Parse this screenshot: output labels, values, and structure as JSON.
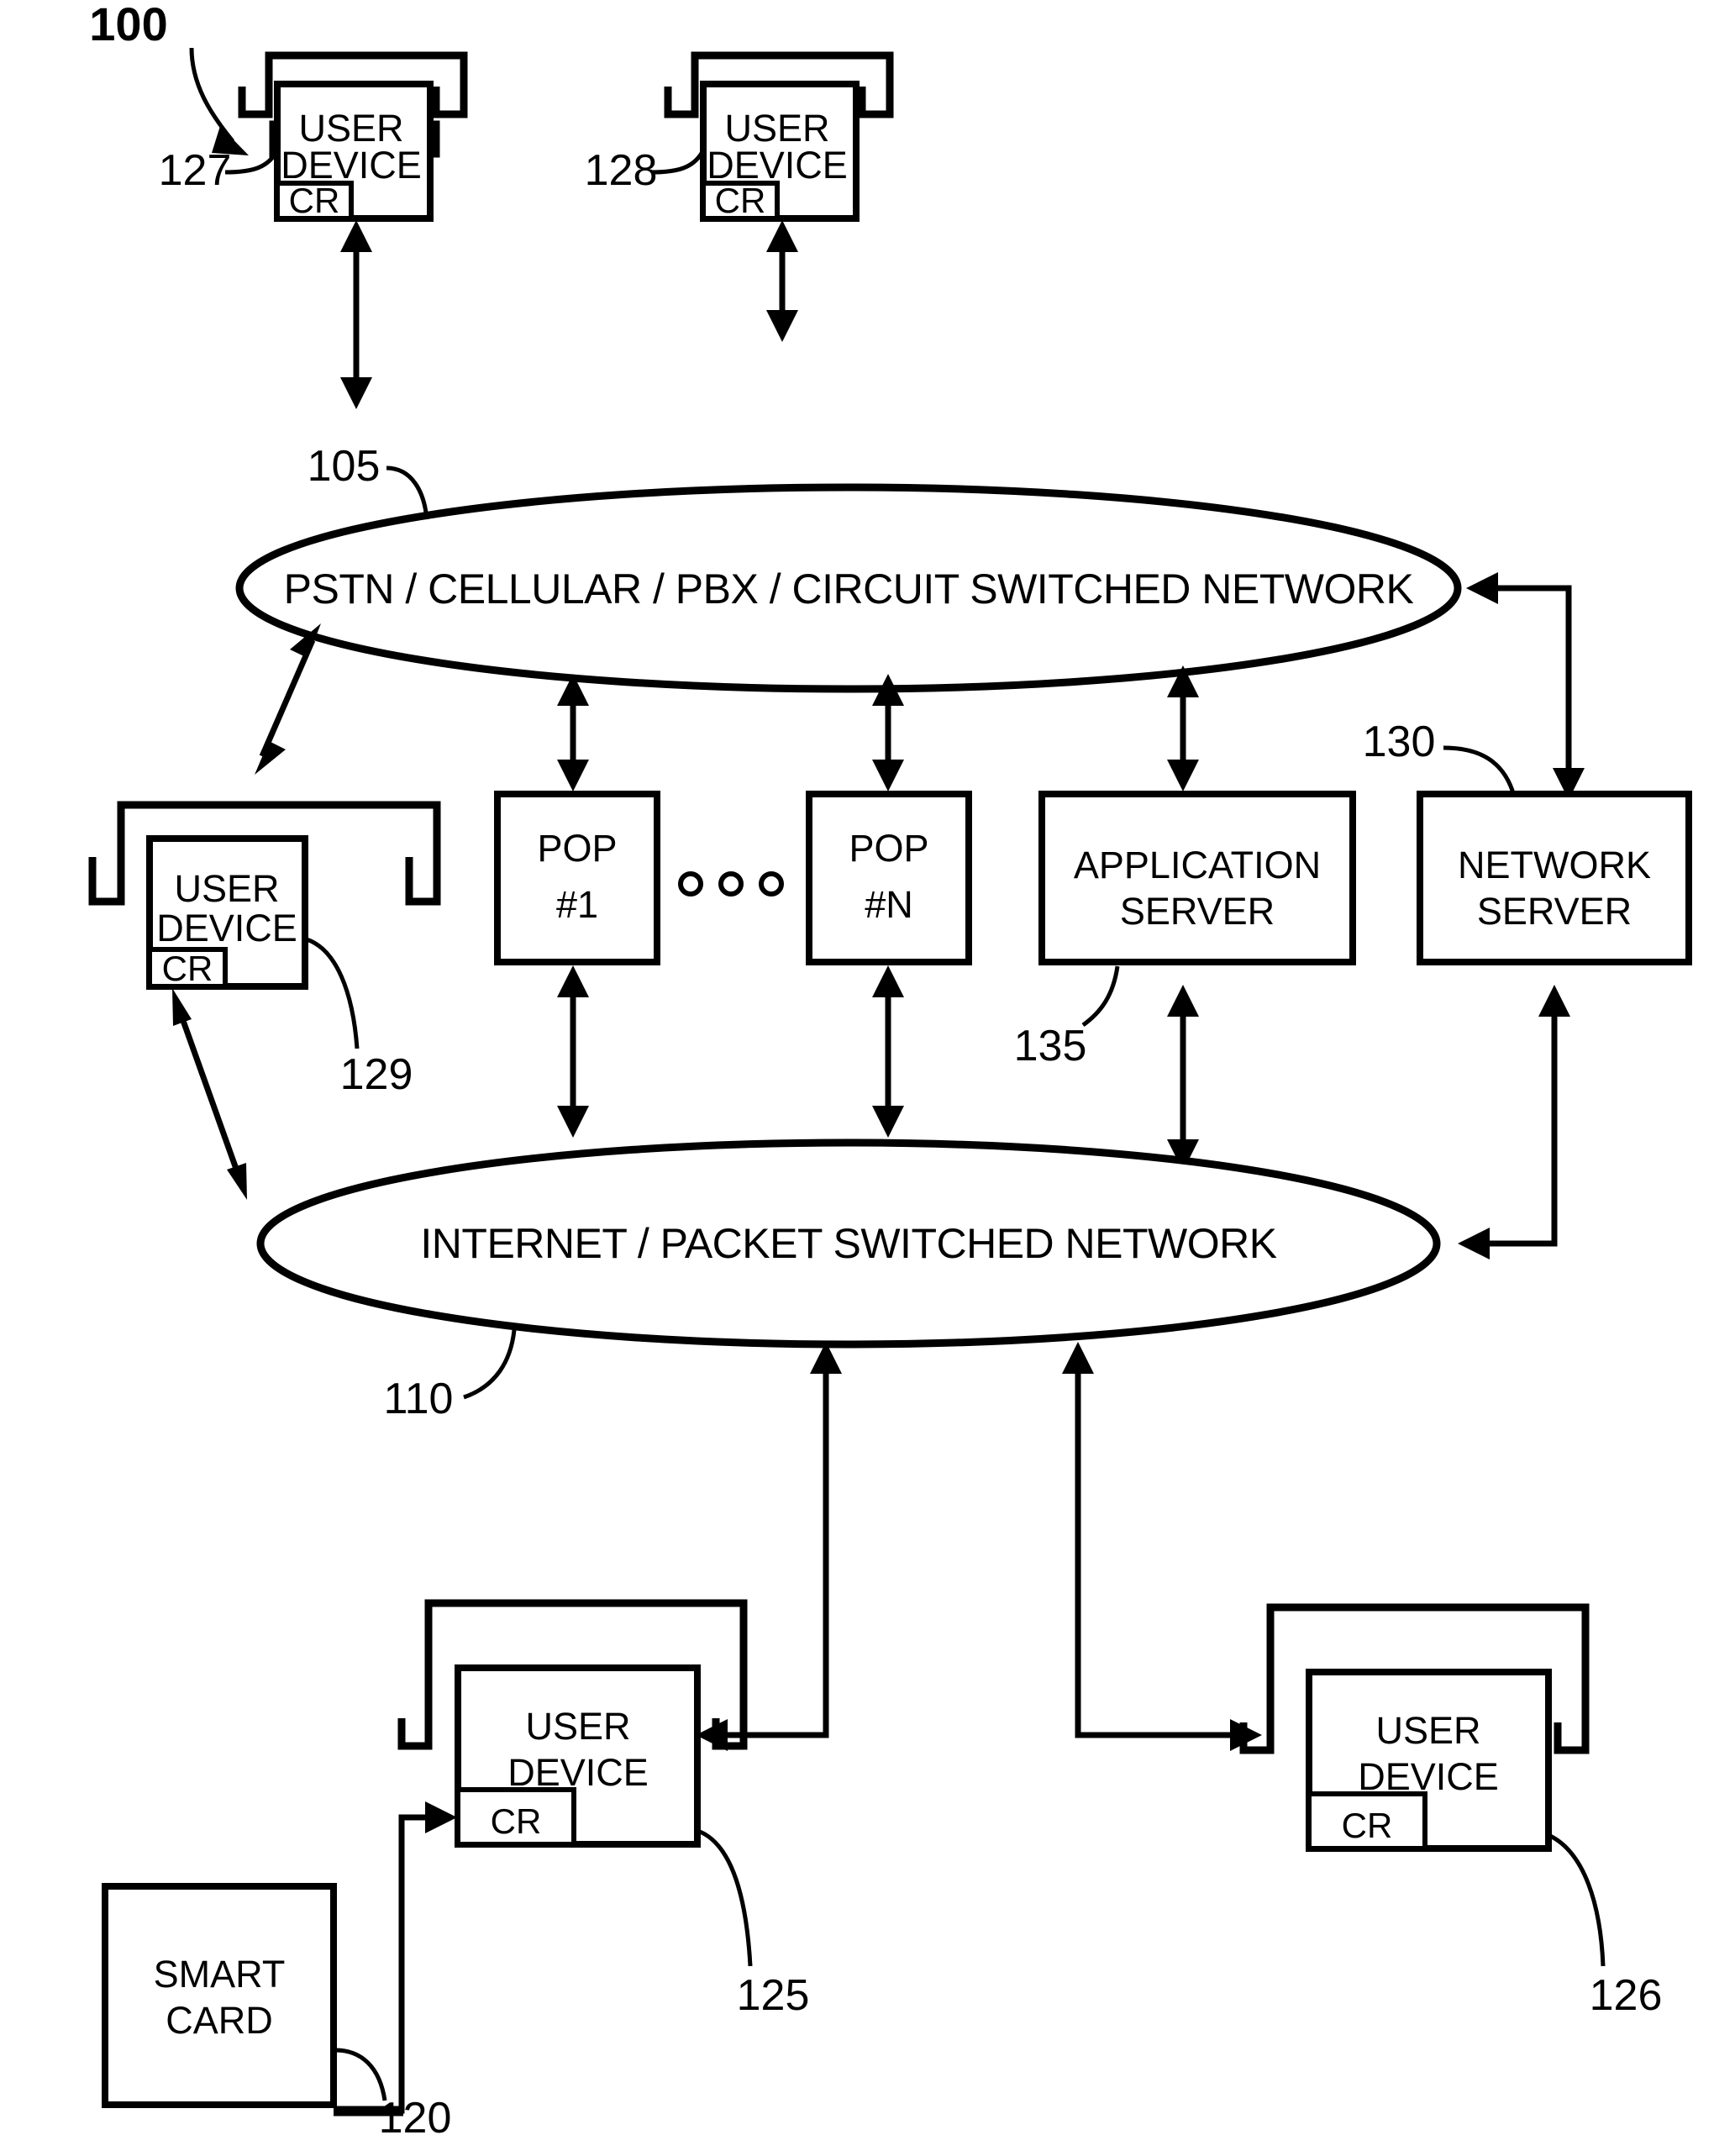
{
  "figure": {
    "number": "100"
  },
  "networks": [
    {
      "id": "pstn",
      "label": "PSTN / CELLULAR / PBX / CIRCUIT SWITCHED NETWORK",
      "ref": "105"
    },
    {
      "id": "internet",
      "label": "INTERNET / PACKET SWITCHED NETWORK",
      "ref": "110"
    }
  ],
  "user_devices": [
    {
      "id": "ud127",
      "line1": "USER",
      "line2": "DEVICE",
      "module": "CR",
      "ref": "127"
    },
    {
      "id": "ud128",
      "line1": "USER",
      "line2": "DEVICE",
      "module": "CR",
      "ref": "128"
    },
    {
      "id": "ud129",
      "line1": "USER",
      "line2": "DEVICE",
      "module": "CR",
      "ref": "129"
    },
    {
      "id": "ud125",
      "line1": "USER",
      "line2": "DEVICE",
      "module": "CR",
      "ref": "125"
    },
    {
      "id": "ud126",
      "line1": "USER",
      "line2": "DEVICE",
      "module": "CR",
      "ref": "126"
    }
  ],
  "pops": [
    {
      "id": "pop1",
      "line1": "POP",
      "line2": "#1"
    },
    {
      "id": "popn",
      "line1": "POP",
      "line2": "#N"
    }
  ],
  "pop_ellipsis": "○ ○ ○",
  "servers": [
    {
      "id": "app_server",
      "line1": "APPLICATION",
      "line2": "SERVER",
      "ref": "135"
    },
    {
      "id": "network_server",
      "line1": "NETWORK",
      "line2": "SERVER",
      "ref": "130"
    }
  ],
  "smart_card": {
    "id": "smartcard",
    "line1": "SMART",
    "line2": "CARD",
    "ref": "120"
  },
  "colors": {
    "stroke": "#000000",
    "background": "#ffffff"
  }
}
